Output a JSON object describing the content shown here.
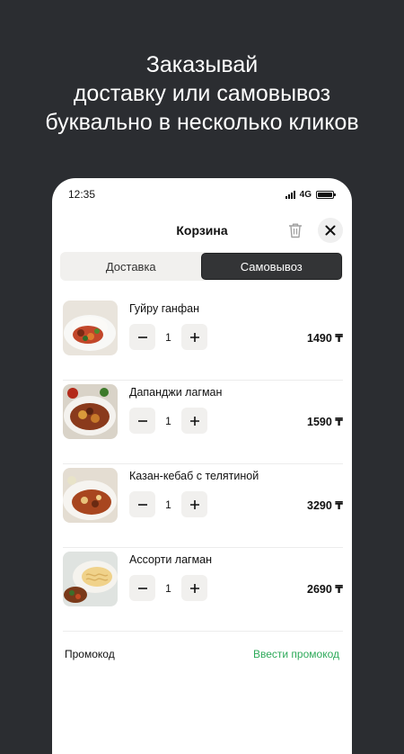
{
  "headline": {
    "line1": "Заказывай",
    "line2": "доставку или самовывоз",
    "line3": "буквально в несколько кликов"
  },
  "status_bar": {
    "time": "12:35",
    "network": "4G"
  },
  "cart": {
    "title": "Корзина",
    "tabs": [
      {
        "label": "Доставка",
        "active": false
      },
      {
        "label": "Самовывоз",
        "active": true
      }
    ],
    "items": [
      {
        "name": "Гуйру ганфан",
        "qty": "1",
        "price": "1490 ₸",
        "image": "food-photo"
      },
      {
        "name": "Дапанджи лагман",
        "qty": "1",
        "price": "1590 ₸",
        "image": "food-photo"
      },
      {
        "name": "Казан-кебаб с телятиной",
        "qty": "1",
        "price": "3290 ₸",
        "image": "food-photo"
      },
      {
        "name": "Ассорти лагман",
        "qty": "1",
        "price": "2690 ₸",
        "image": "food-photo"
      }
    ],
    "promo": {
      "label": "Промокод",
      "action": "Ввести промокод"
    }
  },
  "colors": {
    "background": "#2b2d31",
    "active_tab": "#333436",
    "accent_green": "#2eaa5a"
  }
}
